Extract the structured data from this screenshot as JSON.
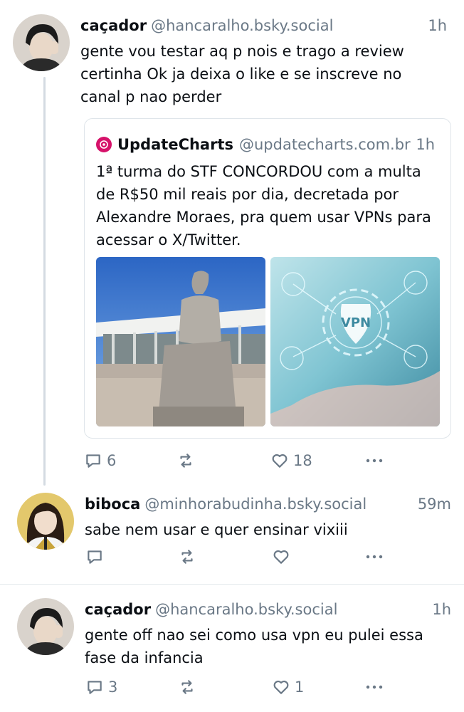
{
  "posts": [
    {
      "name": "caçador",
      "handle": "@hancaralho.bsky.social",
      "time": "1h",
      "text": "gente vou testar aq p nois e trago a review certinha Ok ja deixa o like e se inscreve no canal p nao perder",
      "quote": {
        "name": "UpdateCharts",
        "handle": "@updatecharts.com.br",
        "time": "1h",
        "text": "1ª turma do STF CONCORDOU com a multa de R$50 mil reais por dia, decretada por Alexandre Moraes, pra quem usar VPNs para acessar o X/Twitter.",
        "vpn_text": "VPN"
      },
      "replies": "6",
      "likes": "18"
    },
    {
      "name": "biboca",
      "handle": "@minhorabudinha.bsky.social",
      "time": "59m",
      "text": "sabe nem usar e quer ensinar  vixiii",
      "replies": "",
      "likes": ""
    },
    {
      "name": "caçador",
      "handle": "@hancaralho.bsky.social",
      "time": "1h",
      "text": "gente off nao sei como usa vpn eu pulei essa fase da infancia",
      "replies": "3",
      "likes": "1"
    }
  ],
  "icons": {
    "reply": "reply-icon",
    "repost": "repost-icon",
    "like": "heart-icon",
    "more": "more-icon"
  },
  "colors": {
    "accent_logo": "#d6126a",
    "muted": "#6a7886",
    "thread_line": "#d4dbe2"
  }
}
